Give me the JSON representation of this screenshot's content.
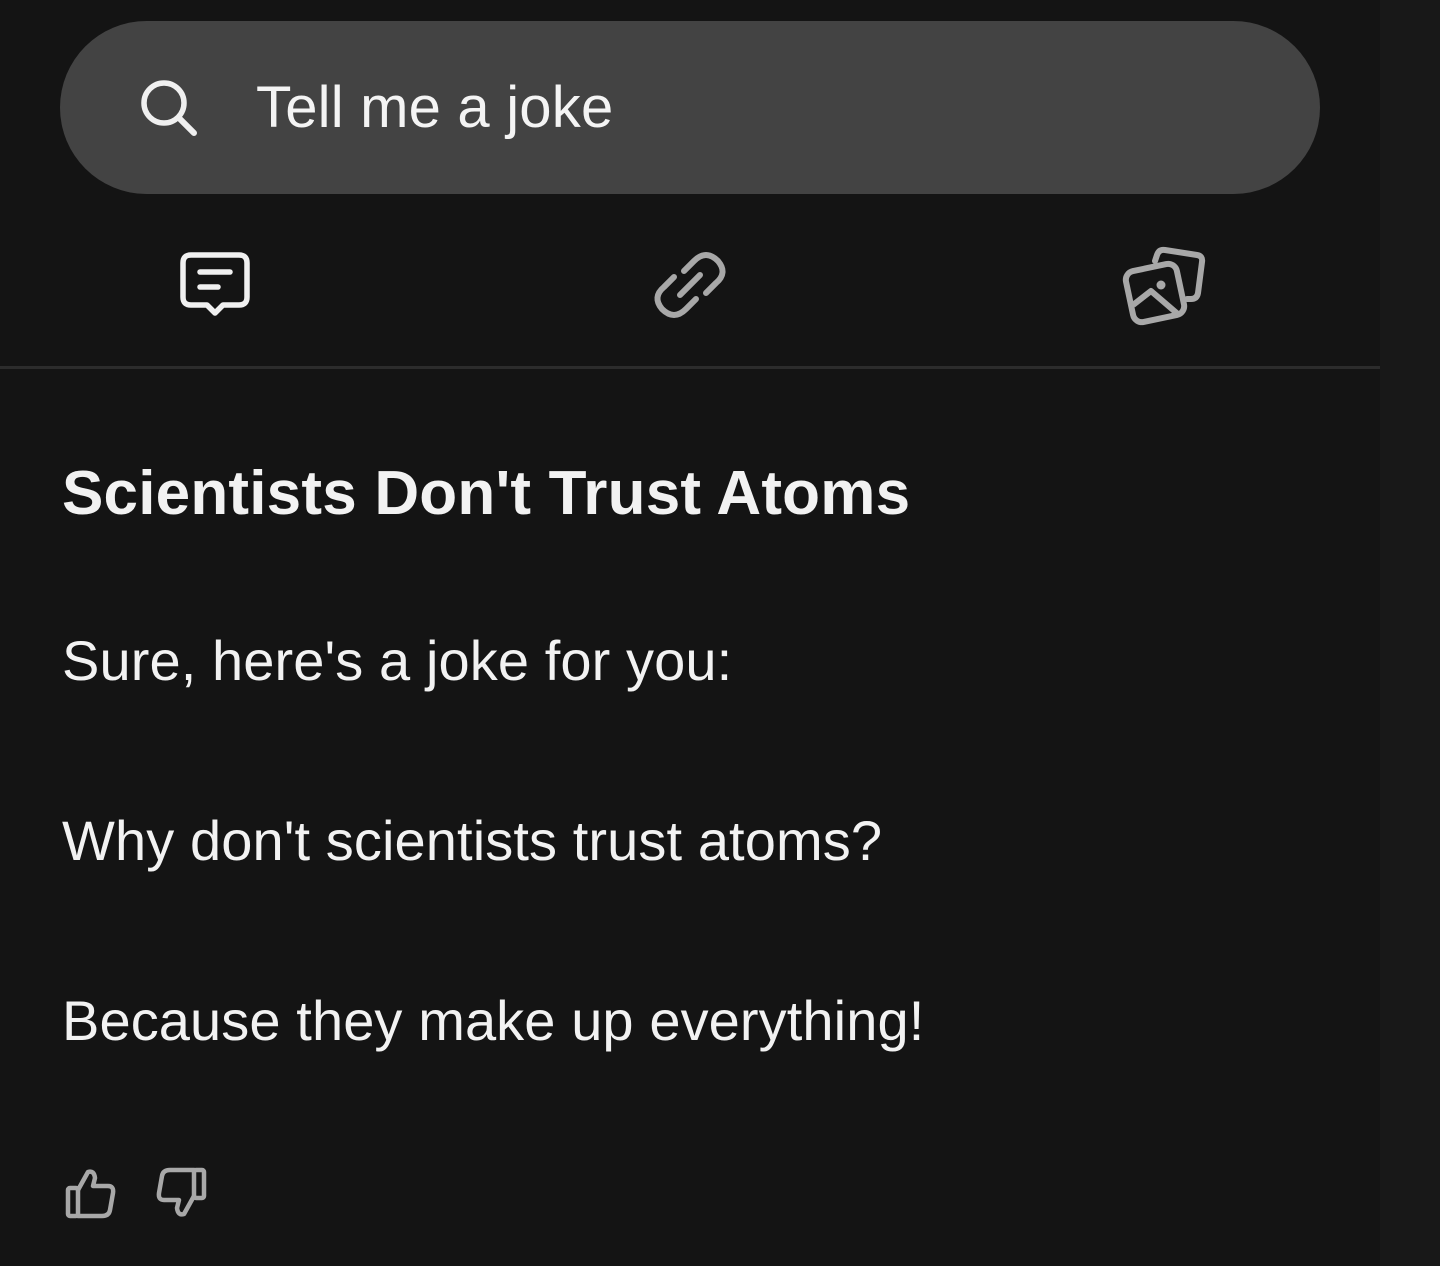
{
  "search": {
    "query": "Tell me a joke",
    "icon": "search-icon"
  },
  "tabs": [
    {
      "name": "chat",
      "icon": "chat-icon",
      "active": true
    },
    {
      "name": "links",
      "icon": "link-icon",
      "active": false
    },
    {
      "name": "images",
      "icon": "images-icon",
      "active": false
    }
  ],
  "answer": {
    "title": "Scientists Don't Trust Atoms",
    "paragraphs": [
      "Sure, here's a joke for you:",
      "Why don't scientists trust atoms?",
      "Because they make up everything!"
    ]
  },
  "feedback": {
    "like_icon": "thumbs-up-icon",
    "dislike_icon": "thumbs-down-icon"
  },
  "colors": {
    "background": "#141414",
    "search_bar": "#434343",
    "active_icon": "#f0f0f0",
    "inactive_icon": "#a8a8a8",
    "text": "#f2f2f2"
  }
}
